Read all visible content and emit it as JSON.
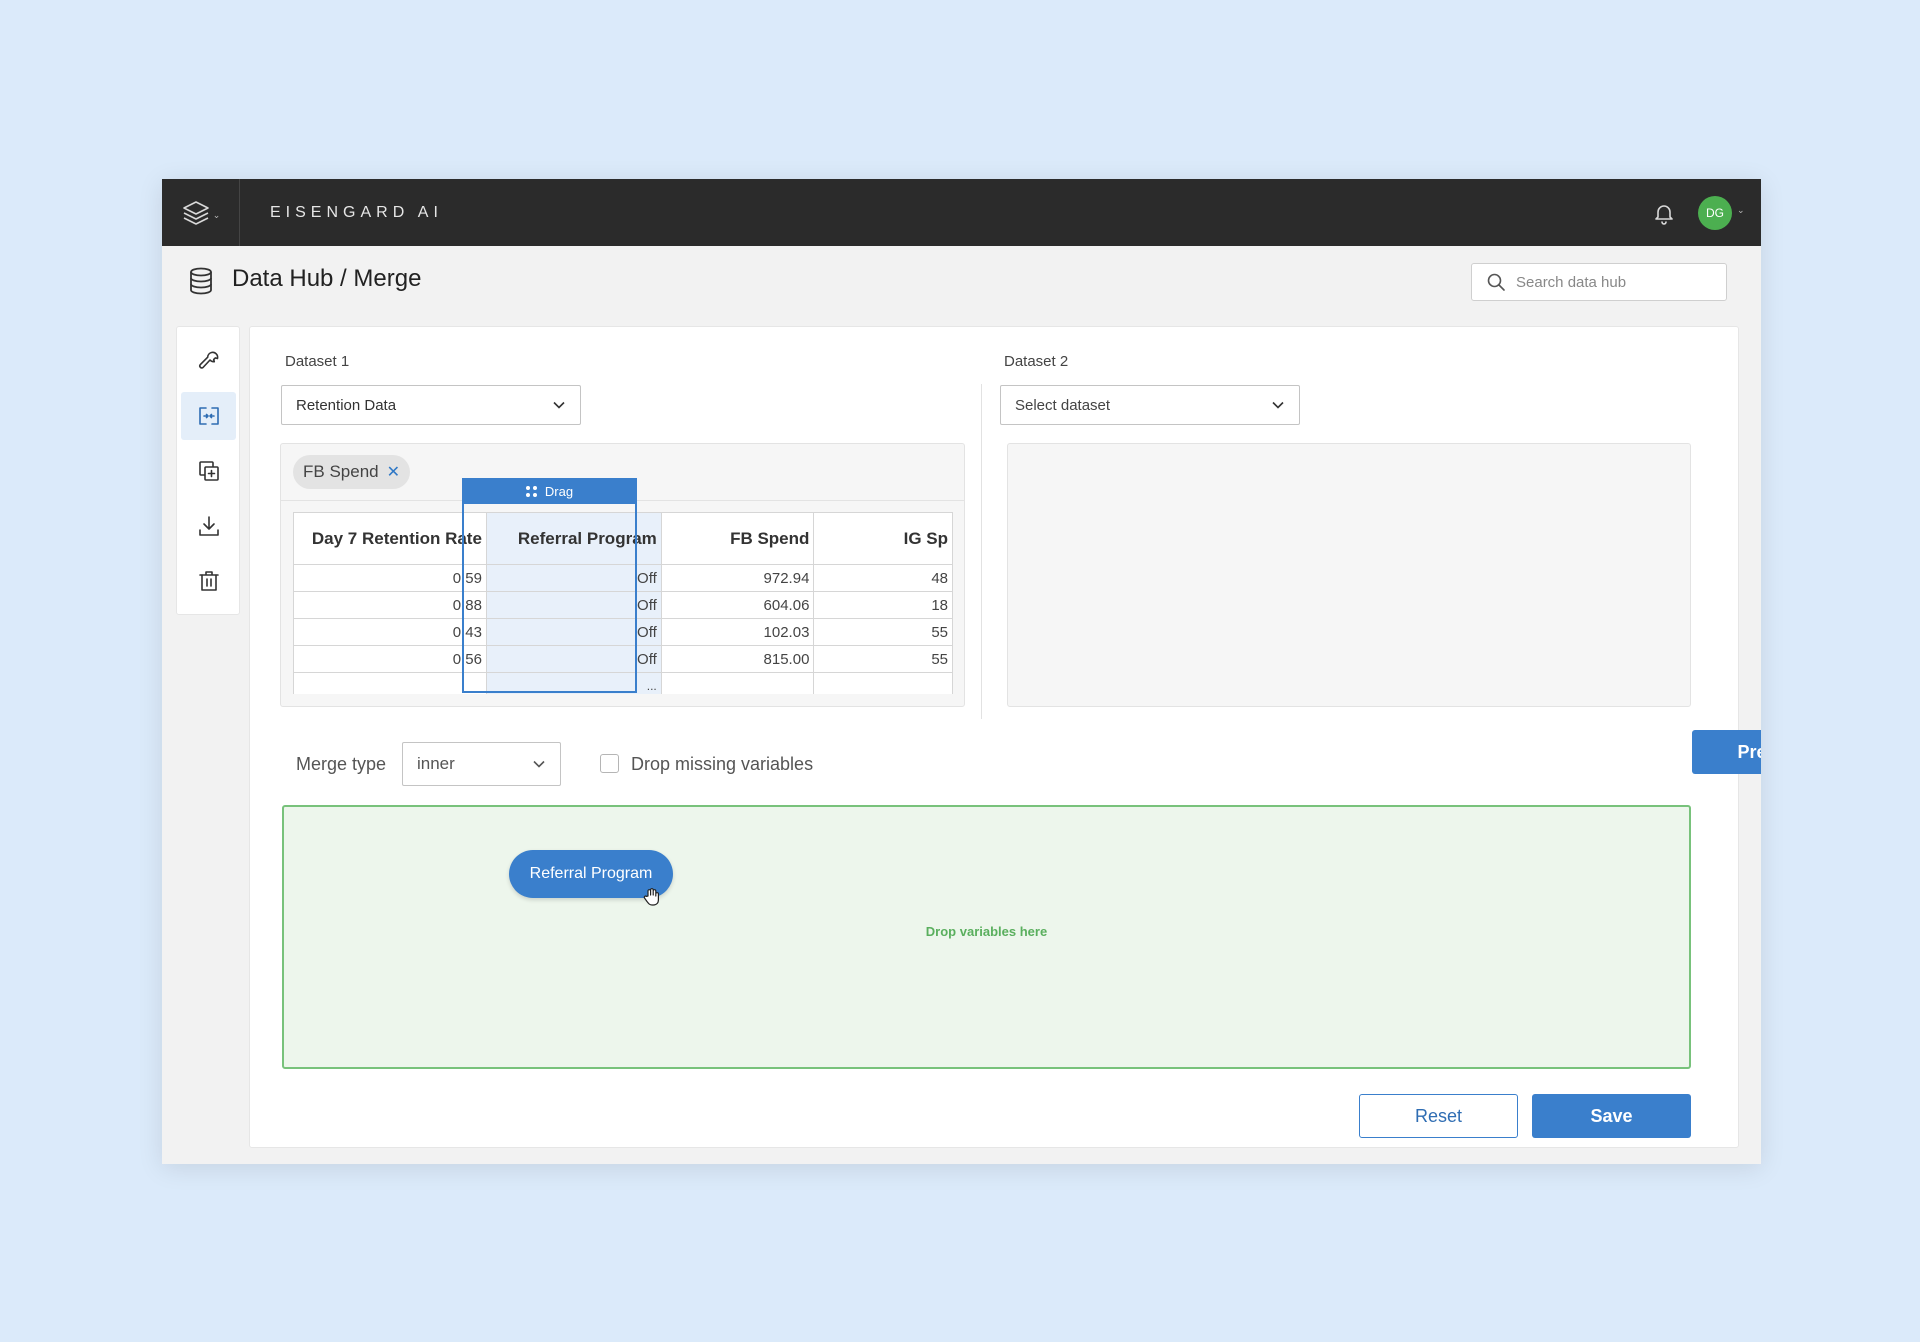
{
  "app": {
    "brand": "EISENGARD AI",
    "user_initials": "DG"
  },
  "header": {
    "title": "Data Hub / Merge",
    "search_placeholder": "Search data hub"
  },
  "toolbar": {
    "items": [
      {
        "icon": "wrench-icon",
        "active": false
      },
      {
        "icon": "merge-icon",
        "active": true
      },
      {
        "icon": "add-copy-icon",
        "active": false
      },
      {
        "icon": "download-icon",
        "active": false
      },
      {
        "icon": "trash-icon",
        "active": false
      }
    ]
  },
  "dataset1": {
    "label": "Dataset 1",
    "selected": "Retention Data",
    "chip": "FB Spend",
    "drag_label": "Drag",
    "columns": [
      "Day 7 Retention Rate",
      "Referral Program",
      "FB Spend",
      "IG Sp"
    ],
    "rows": [
      [
        "0.59",
        "Off",
        "972.94",
        "48"
      ],
      [
        "0.88",
        "Off",
        "604.06",
        "18"
      ],
      [
        "0.43",
        "Off",
        "102.03",
        "55"
      ],
      [
        "0.56",
        "Off",
        "815.00",
        "55"
      ]
    ],
    "more_indicator": "..."
  },
  "dataset2": {
    "label": "Dataset 2",
    "placeholder": "Select dataset"
  },
  "merge": {
    "type_label": "Merge type",
    "type_value": "inner",
    "drop_missing_label": "Drop missing variables",
    "drop_missing_checked": false,
    "preview_label": "Preview",
    "drop_zone_text": "Drop variables here",
    "dragged_variable": "Referral Program"
  },
  "actions": {
    "reset_label": "Reset",
    "save_label": "Save"
  },
  "colors": {
    "accent": "#3a7fcc",
    "topbar": "#2b2b2b",
    "avatar": "#4caf50",
    "drop_border": "#78c27b",
    "page_bg": "#dbeafa"
  }
}
